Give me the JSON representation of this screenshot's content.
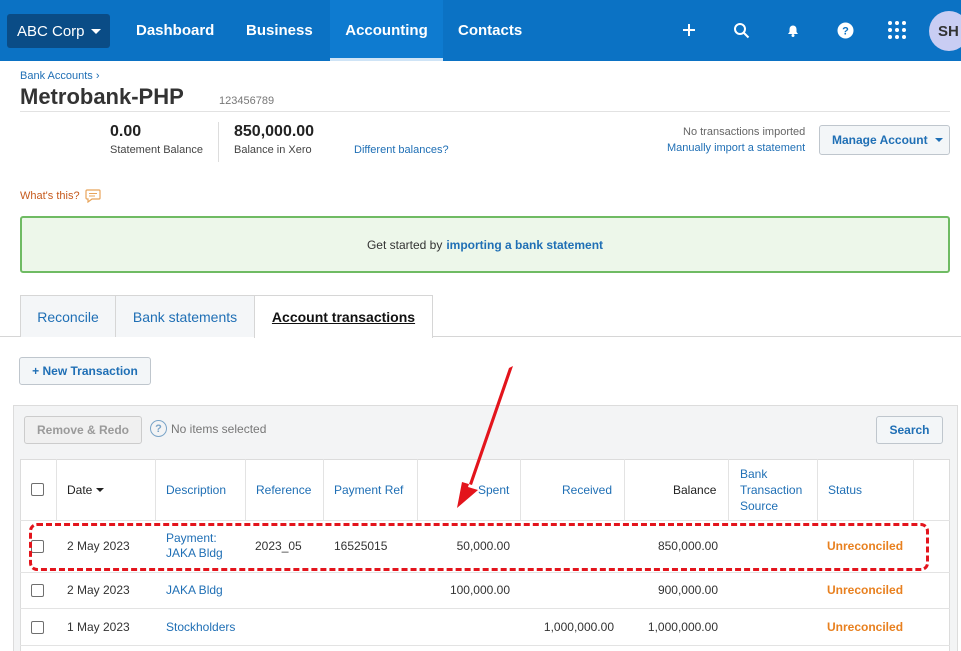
{
  "topnav": {
    "org": "ABC Corp",
    "items": [
      {
        "label": "Dashboard",
        "active": false
      },
      {
        "label": "Business",
        "active": false
      },
      {
        "label": "Accounting",
        "active": true
      },
      {
        "label": "Contacts",
        "active": false
      }
    ],
    "icons": [
      "plus-icon",
      "search-icon",
      "bell-icon",
      "help-icon",
      "apps-grid-icon"
    ],
    "avatar": "SH"
  },
  "header": {
    "breadcrumb": "Bank Accounts ›",
    "title": "Metrobank-PHP",
    "account_number": "123456789"
  },
  "balances": {
    "statement_value": "0.00",
    "statement_label": "Statement Balance",
    "xero_value": "850,000.00",
    "xero_label": "Balance in Xero",
    "different_link": "Different balances?",
    "no_transactions": "No transactions imported",
    "manual_import": "Manually import a statement",
    "manage_account": "Manage Account"
  },
  "whats_this": "What's this?",
  "banner": {
    "text": "Get started by",
    "link": "importing a bank statement"
  },
  "tabs": [
    {
      "label": "Reconcile",
      "active": false
    },
    {
      "label": "Bank statements",
      "active": false
    },
    {
      "label": "Account transactions",
      "active": true
    }
  ],
  "toolbar": {
    "new_transaction": "+ New Transaction",
    "remove_redo": "Remove & Redo",
    "help_glyph": "?",
    "no_items": "No items selected",
    "search": "Search"
  },
  "table": {
    "headers": {
      "date": "Date",
      "description": "Description",
      "reference": "Reference",
      "payment_ref": "Payment Ref",
      "spent": "Spent",
      "received": "Received",
      "balance": "Balance",
      "source_1": "Bank",
      "source_2": "Transaction",
      "source_3": "Source",
      "status": "Status"
    },
    "rows": [
      {
        "date": "2 May 2023",
        "description_1": "Payment:",
        "description_2": "JAKA Bldg",
        "reference": "2023_05",
        "payment_ref": "16525015",
        "spent": "50,000.00",
        "received": "",
        "balance": "850,000.00",
        "source": "",
        "status": "Unreconciled"
      },
      {
        "date": "2 May 2023",
        "description_1": "JAKA Bldg",
        "description_2": "",
        "reference": "",
        "payment_ref": "",
        "spent": "100,000.00",
        "received": "",
        "balance": "900,000.00",
        "source": "",
        "status": "Unreconciled"
      },
      {
        "date": "1 May 2023",
        "description_1": "Stockholders",
        "description_2": "",
        "reference": "",
        "payment_ref": "",
        "spent": "",
        "received": "1,000,000.00",
        "balance": "1,000,000.00",
        "source": "",
        "status": "Unreconciled"
      }
    ]
  },
  "colors": {
    "nav_bg": "#0b72c4",
    "link": "#1f6fb5",
    "status_unreconciled": "#e8801f",
    "annotation": "#e3141c",
    "banner_border": "#6fbb63"
  }
}
